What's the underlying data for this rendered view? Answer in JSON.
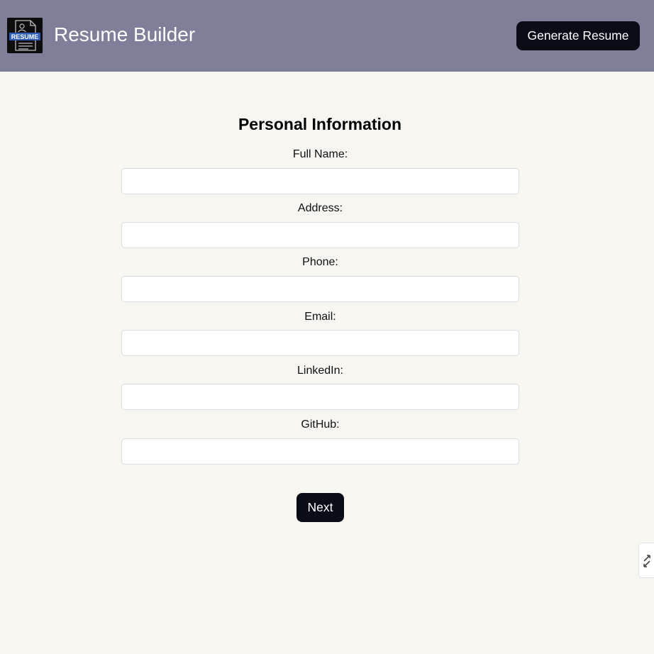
{
  "header": {
    "logo_text": "RESUME",
    "title": "Resume Builder",
    "generate_label": "Generate Resume",
    "background": "#7f7f9a"
  },
  "form": {
    "section_title": "Personal Information",
    "fields": [
      {
        "label": "Full Name:",
        "value": ""
      },
      {
        "label": "Address:",
        "value": ""
      },
      {
        "label": "Phone:",
        "value": ""
      },
      {
        "label": "Email:",
        "value": ""
      },
      {
        "label": "LinkedIn:",
        "value": ""
      },
      {
        "label": "GitHub:",
        "value": ""
      }
    ],
    "next_label": "Next"
  },
  "side_widget": {
    "icon": "collapse-arrows-icon"
  },
  "colors": {
    "page_background": "#f7f6f1",
    "button_background": "#0b0d16",
    "logo_accent": "#2f5fb5"
  }
}
